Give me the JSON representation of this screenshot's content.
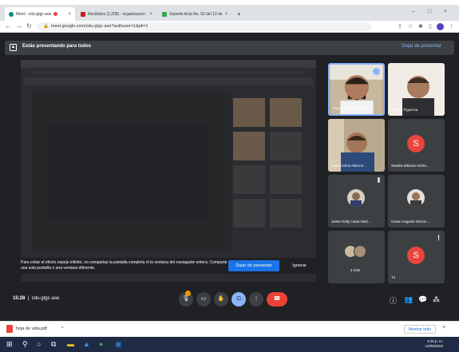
{
  "browser": {
    "tabs": [
      {
        "label": "Meet - cdu-gtgc-ase",
        "active": true
      },
      {
        "label": "Recibidos (1.258) - organizacion",
        "active": false
      },
      {
        "label": "Soporte Acta No. 02 del 12 de",
        "active": false
      }
    ],
    "new_tab": "+",
    "url": "meet.google.com/cdu-gtgc-ase?authuser=1&pli=1"
  },
  "meet": {
    "presenting_label": "Estás presentando para todos",
    "stop_presenting": "Dejar de presentar",
    "warning_text": "Para evitar el efecto espejo infinito, no compartas la pantalla completa ni la ventana del navegador entera. Comparte una sola pestaña o una ventana diferente.",
    "present_button": "Dejar de presentar",
    "ignore_button": "Ignorar",
    "meeting_time": "15:28",
    "meeting_code": "cdu-gtgc-ase",
    "participants": [
      {
        "name": "Fray Paulo Zuluga Ver...",
        "type": "photo"
      },
      {
        "name": "Alberto Figueroa",
        "type": "photo"
      },
      {
        "name": "Juan Carlos Alarcon...",
        "type": "photo"
      },
      {
        "name": "Sandra Bibiana Andra...",
        "type": "avatar",
        "initial": "S"
      },
      {
        "name": "Jaime Eddy Usaa Garz...",
        "type": "circle"
      },
      {
        "name": "Cesar Augusto Garcia ...",
        "type": "circle"
      },
      {
        "name": "2 más",
        "type": "group"
      },
      {
        "name": "Tú",
        "type": "avatar",
        "initial": "S"
      }
    ]
  },
  "downloads": {
    "file": "hoja de vida.pdf",
    "show_all": "Mostrar todo"
  },
  "taskbar": {
    "time": "3:28 p. m.",
    "date": "12/05/2022"
  },
  "colors": {
    "accent": "#1a73e8",
    "meet_bg": "#202124",
    "tile": "#3c4043",
    "end_call": "#ea4335"
  }
}
